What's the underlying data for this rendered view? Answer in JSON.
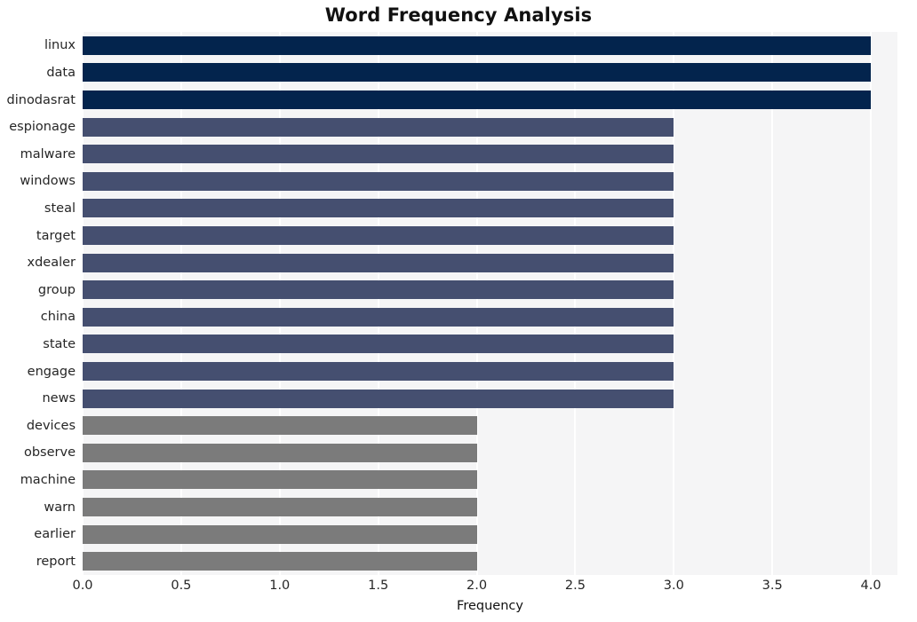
{
  "chart_data": {
    "type": "bar",
    "orientation": "horizontal",
    "title": "Word Frequency Analysis",
    "xlabel": "Frequency",
    "ylabel": "",
    "categories": [
      "linux",
      "data",
      "dinodasrat",
      "espionage",
      "malware",
      "windows",
      "steal",
      "target",
      "xdealer",
      "group",
      "china",
      "state",
      "engage",
      "news",
      "devices",
      "observe",
      "machine",
      "warn",
      "earlier",
      "report"
    ],
    "values": [
      4,
      4,
      4,
      3,
      3,
      3,
      3,
      3,
      3,
      3,
      3,
      3,
      3,
      3,
      2,
      2,
      2,
      2,
      2,
      2
    ],
    "bar_colors": [
      "#03244d",
      "#03244d",
      "#03244d",
      "#454f70",
      "#454f70",
      "#454f70",
      "#454f70",
      "#454f70",
      "#454f70",
      "#454f70",
      "#454f70",
      "#454f70",
      "#454f70",
      "#454f70",
      "#7b7b7b",
      "#7b7b7b",
      "#7b7b7b",
      "#7b7b7b",
      "#7b7b7b",
      "#7b7b7b"
    ],
    "xlim": [
      0.0,
      4.135
    ],
    "xticks": [
      0.0,
      0.5,
      1.0,
      1.5,
      2.0,
      2.5,
      3.0,
      3.5,
      4.0
    ],
    "xticklabels": [
      "0.0",
      "0.5",
      "1.0",
      "1.5",
      "2.0",
      "2.5",
      "3.0",
      "3.5",
      "4.0"
    ],
    "grid": {
      "vertical": true,
      "horizontal": false,
      "color": "#ffffff"
    },
    "legend": null,
    "plot_background": "#f5f5f6",
    "figure_background": "#ffffff"
  },
  "colors": {
    "navy": "#03244d",
    "slate": "#454f70",
    "gray": "#7b7b7b",
    "plot_bg": "#f5f5f6",
    "grid": "#ffffff",
    "text": "#262626"
  }
}
